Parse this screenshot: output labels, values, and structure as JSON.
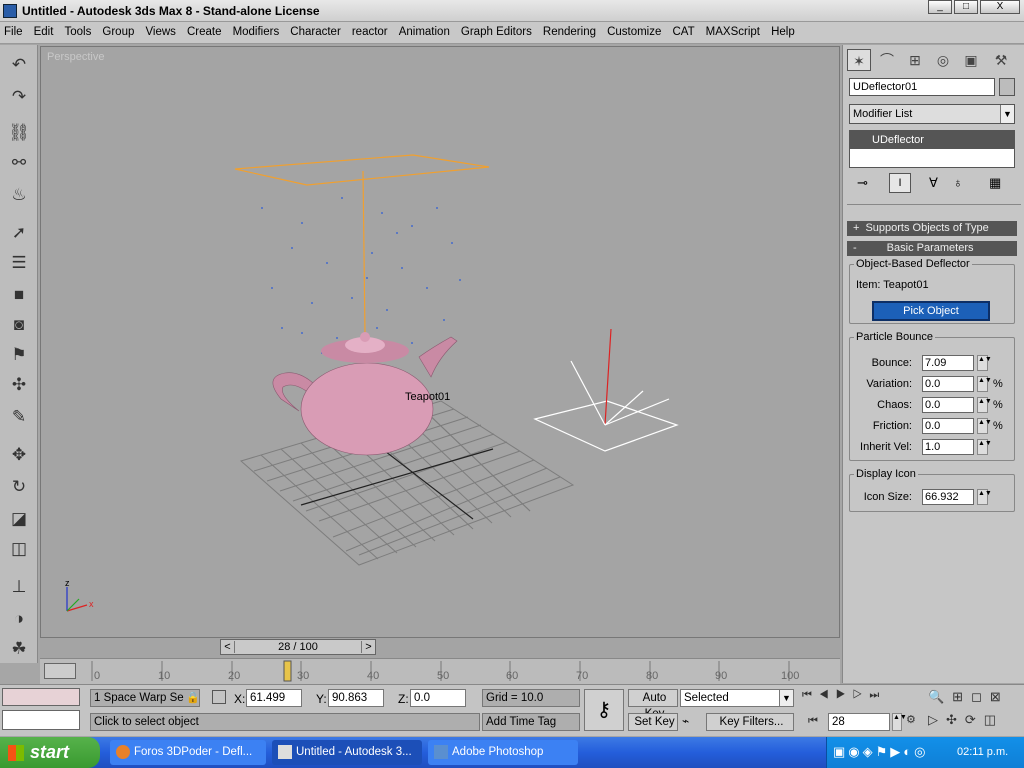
{
  "app": {
    "title": "Untitled - Autodesk 3ds Max 8 - Stand-alone License"
  },
  "window_controls": {
    "minimize": "_",
    "maximize": "□",
    "close": "X"
  },
  "menu": [
    "File",
    "Edit",
    "Tools",
    "Group",
    "Views",
    "Create",
    "Modifiers",
    "Character",
    "reactor",
    "Animation",
    "Graph Editors",
    "Rendering",
    "Customize",
    "CAT",
    "MAXScript",
    "Help"
  ],
  "viewport": {
    "label": "Perspective",
    "object_label": "Teapot01",
    "axis_x": "x",
    "axis_z": "z"
  },
  "time": {
    "frame_display": "28 / 100",
    "current_frame": 28,
    "total_frames": 100,
    "prev": "<",
    "next": ">"
  },
  "timeline": {
    "ticks": [
      "0",
      "10",
      "20",
      "30",
      "40",
      "50",
      "60",
      "70",
      "80",
      "90",
      "100"
    ]
  },
  "command_panel": {
    "object_name": "UDeflector01",
    "modifier_list": "Modifier List",
    "stack_item": "UDeflector",
    "rollout_supports": "Supports Objects of Type",
    "rollout_basic": "Basic Parameters",
    "plus": "+",
    "minus": "-",
    "group_object": "Object-Based Deflector",
    "item_label": "Item: Teapot01",
    "pick_button": "Pick Object",
    "group_bounce": "Particle Bounce",
    "params": [
      {
        "label": "Bounce:",
        "value": "7.09",
        "unit": ""
      },
      {
        "label": "Variation:",
        "value": "0.0",
        "unit": "%"
      },
      {
        "label": "Chaos:",
        "value": "0.0",
        "unit": "%"
      },
      {
        "label": "Friction:",
        "value": "0.0",
        "unit": "%"
      },
      {
        "label": "Inherit Vel:",
        "value": "1.0",
        "unit": ""
      }
    ],
    "group_display": "Display Icon",
    "icon_size_label": "Icon Size:",
    "icon_size_value": "66.932"
  },
  "status": {
    "selection": "1 Space Warp Se",
    "x_label": "X:",
    "x_value": "61.499",
    "y_label": "Y:",
    "y_value": "90.863",
    "z_label": "Z:",
    "z_value": "0.0",
    "grid": "Grid = 10.0",
    "prompt": "Click to select object",
    "add_time_tag": "Add Time Tag",
    "auto_key": "Auto Key",
    "set_key": "Set Key",
    "selected": "Selected",
    "key_filters": "Key Filters...",
    "frame_field": "28"
  },
  "taskbar": {
    "start": "start",
    "items": [
      "Foros 3DPoder - Defl...",
      "Untitled - Autodesk 3...",
      "Adobe Photoshop"
    ],
    "clock": "02:11 p.m."
  },
  "colors": {
    "viewport_bg": "#a4a4a4",
    "teapot": "#d99cb5",
    "deflector": "#f0a030",
    "panel": "#c6c6c6",
    "selected_blue": "#1c60b8"
  }
}
